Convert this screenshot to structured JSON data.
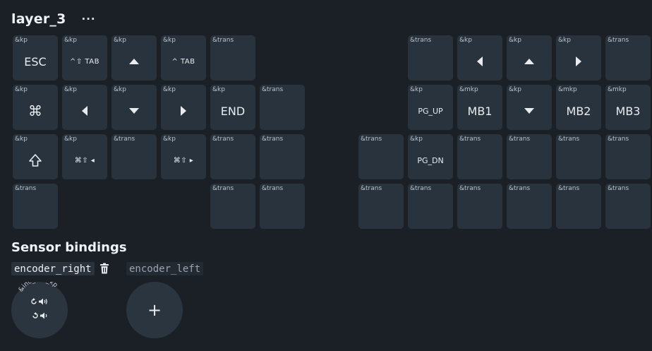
{
  "layer": {
    "title": "layer_3",
    "menu_label": "···"
  },
  "keys": [
    {
      "id": "k0",
      "behavior": "&kp",
      "param": "ESC",
      "icon": ""
    },
    {
      "id": "k1",
      "behavior": "&kp",
      "param": "^⇧ TAB",
      "icon": ""
    },
    {
      "id": "k2",
      "behavior": "&kp",
      "param": "",
      "icon": "up-arrow-icon"
    },
    {
      "id": "k3",
      "behavior": "&kp",
      "param": "^ TAB",
      "icon": ""
    },
    {
      "id": "k4",
      "behavior": "&trans",
      "param": "",
      "icon": ""
    },
    {
      "id": "k5",
      "behavior": "&trans",
      "param": "",
      "icon": ""
    },
    {
      "id": "k6",
      "behavior": "&kp",
      "param": "",
      "icon": "left-arrow-icon"
    },
    {
      "id": "k7",
      "behavior": "&kp",
      "param": "",
      "icon": "up-arrow-icon"
    },
    {
      "id": "k8",
      "behavior": "&kp",
      "param": "",
      "icon": "right-arrow-icon"
    },
    {
      "id": "k9",
      "behavior": "&trans",
      "param": "",
      "icon": ""
    },
    {
      "id": "k10",
      "behavior": "&kp",
      "param": "⌘",
      "icon": ""
    },
    {
      "id": "k11",
      "behavior": "&kp",
      "param": "",
      "icon": "left-arrow-icon"
    },
    {
      "id": "k12",
      "behavior": "&kp",
      "param": "",
      "icon": "down-arrow-icon"
    },
    {
      "id": "k13",
      "behavior": "&kp",
      "param": "",
      "icon": "right-arrow-icon"
    },
    {
      "id": "k14",
      "behavior": "&kp",
      "param": "END",
      "icon": ""
    },
    {
      "id": "k15",
      "behavior": "&trans",
      "param": "",
      "icon": ""
    },
    {
      "id": "k16",
      "behavior": "&kp",
      "param": "PG_UP",
      "icon": ""
    },
    {
      "id": "k17",
      "behavior": "&mkp",
      "param": "MB1",
      "icon": ""
    },
    {
      "id": "k18",
      "behavior": "&kp",
      "param": "",
      "icon": "down-arrow-icon"
    },
    {
      "id": "k19",
      "behavior": "&mkp",
      "param": "MB2",
      "icon": ""
    },
    {
      "id": "k20",
      "behavior": "&mkp",
      "param": "MB3",
      "icon": ""
    },
    {
      "id": "k21",
      "behavior": "&kp",
      "param": "",
      "icon": "shift-icon"
    },
    {
      "id": "k22",
      "behavior": "&kp",
      "param": "⌘⇧ ◂",
      "icon": ""
    },
    {
      "id": "k23",
      "behavior": "&trans",
      "param": "",
      "icon": ""
    },
    {
      "id": "k24",
      "behavior": "&kp",
      "param": "⌘⇧ ▸",
      "icon": ""
    },
    {
      "id": "k25",
      "behavior": "&trans",
      "param": "",
      "icon": ""
    },
    {
      "id": "k26",
      "behavior": "&trans",
      "param": "",
      "icon": ""
    },
    {
      "id": "k27",
      "behavior": "&trans",
      "param": "",
      "icon": ""
    },
    {
      "id": "k28",
      "behavior": "&kp",
      "param": "PG_DN",
      "icon": ""
    },
    {
      "id": "k29",
      "behavior": "&trans",
      "param": "",
      "icon": ""
    },
    {
      "id": "k30",
      "behavior": "&trans",
      "param": "",
      "icon": ""
    },
    {
      "id": "k31",
      "behavior": "&trans",
      "param": "",
      "icon": ""
    },
    {
      "id": "k32",
      "behavior": "&trans",
      "param": "",
      "icon": ""
    },
    {
      "id": "k33",
      "behavior": "&trans",
      "param": "",
      "icon": ""
    },
    {
      "id": "k34",
      "behavior": "&trans",
      "param": "",
      "icon": ""
    },
    {
      "id": "k35",
      "behavior": "&trans",
      "param": "",
      "icon": ""
    },
    {
      "id": "k36",
      "behavior": "&trans",
      "param": "",
      "icon": ""
    },
    {
      "id": "k37",
      "behavior": "&trans",
      "param": "",
      "icon": ""
    },
    {
      "id": "k38",
      "behavior": "&trans",
      "param": "",
      "icon": ""
    },
    {
      "id": "k39",
      "behavior": "&trans",
      "param": "",
      "icon": ""
    },
    {
      "id": "k40",
      "behavior": "&trans",
      "param": "",
      "icon": ""
    },
    {
      "id": "k41",
      "behavior": "&trans",
      "param": "",
      "icon": ""
    }
  ],
  "sensors": {
    "title": "Sensor bindings",
    "tabs": [
      "encoder_right",
      "encoder_left"
    ],
    "delete_icon": "trash-icon",
    "encoder_binding": {
      "behavior": "&inc_dec_kp",
      "clockwise_icons": [
        "rotate-cw-icon",
        "volume-up-icon"
      ],
      "counter_clockwise_icons": [
        "rotate-ccw-icon",
        "volume-down-icon"
      ]
    },
    "add_label": "+"
  },
  "colors": {
    "background": "#1b2027",
    "key": "#29333d",
    "text": "#e8ebef"
  }
}
